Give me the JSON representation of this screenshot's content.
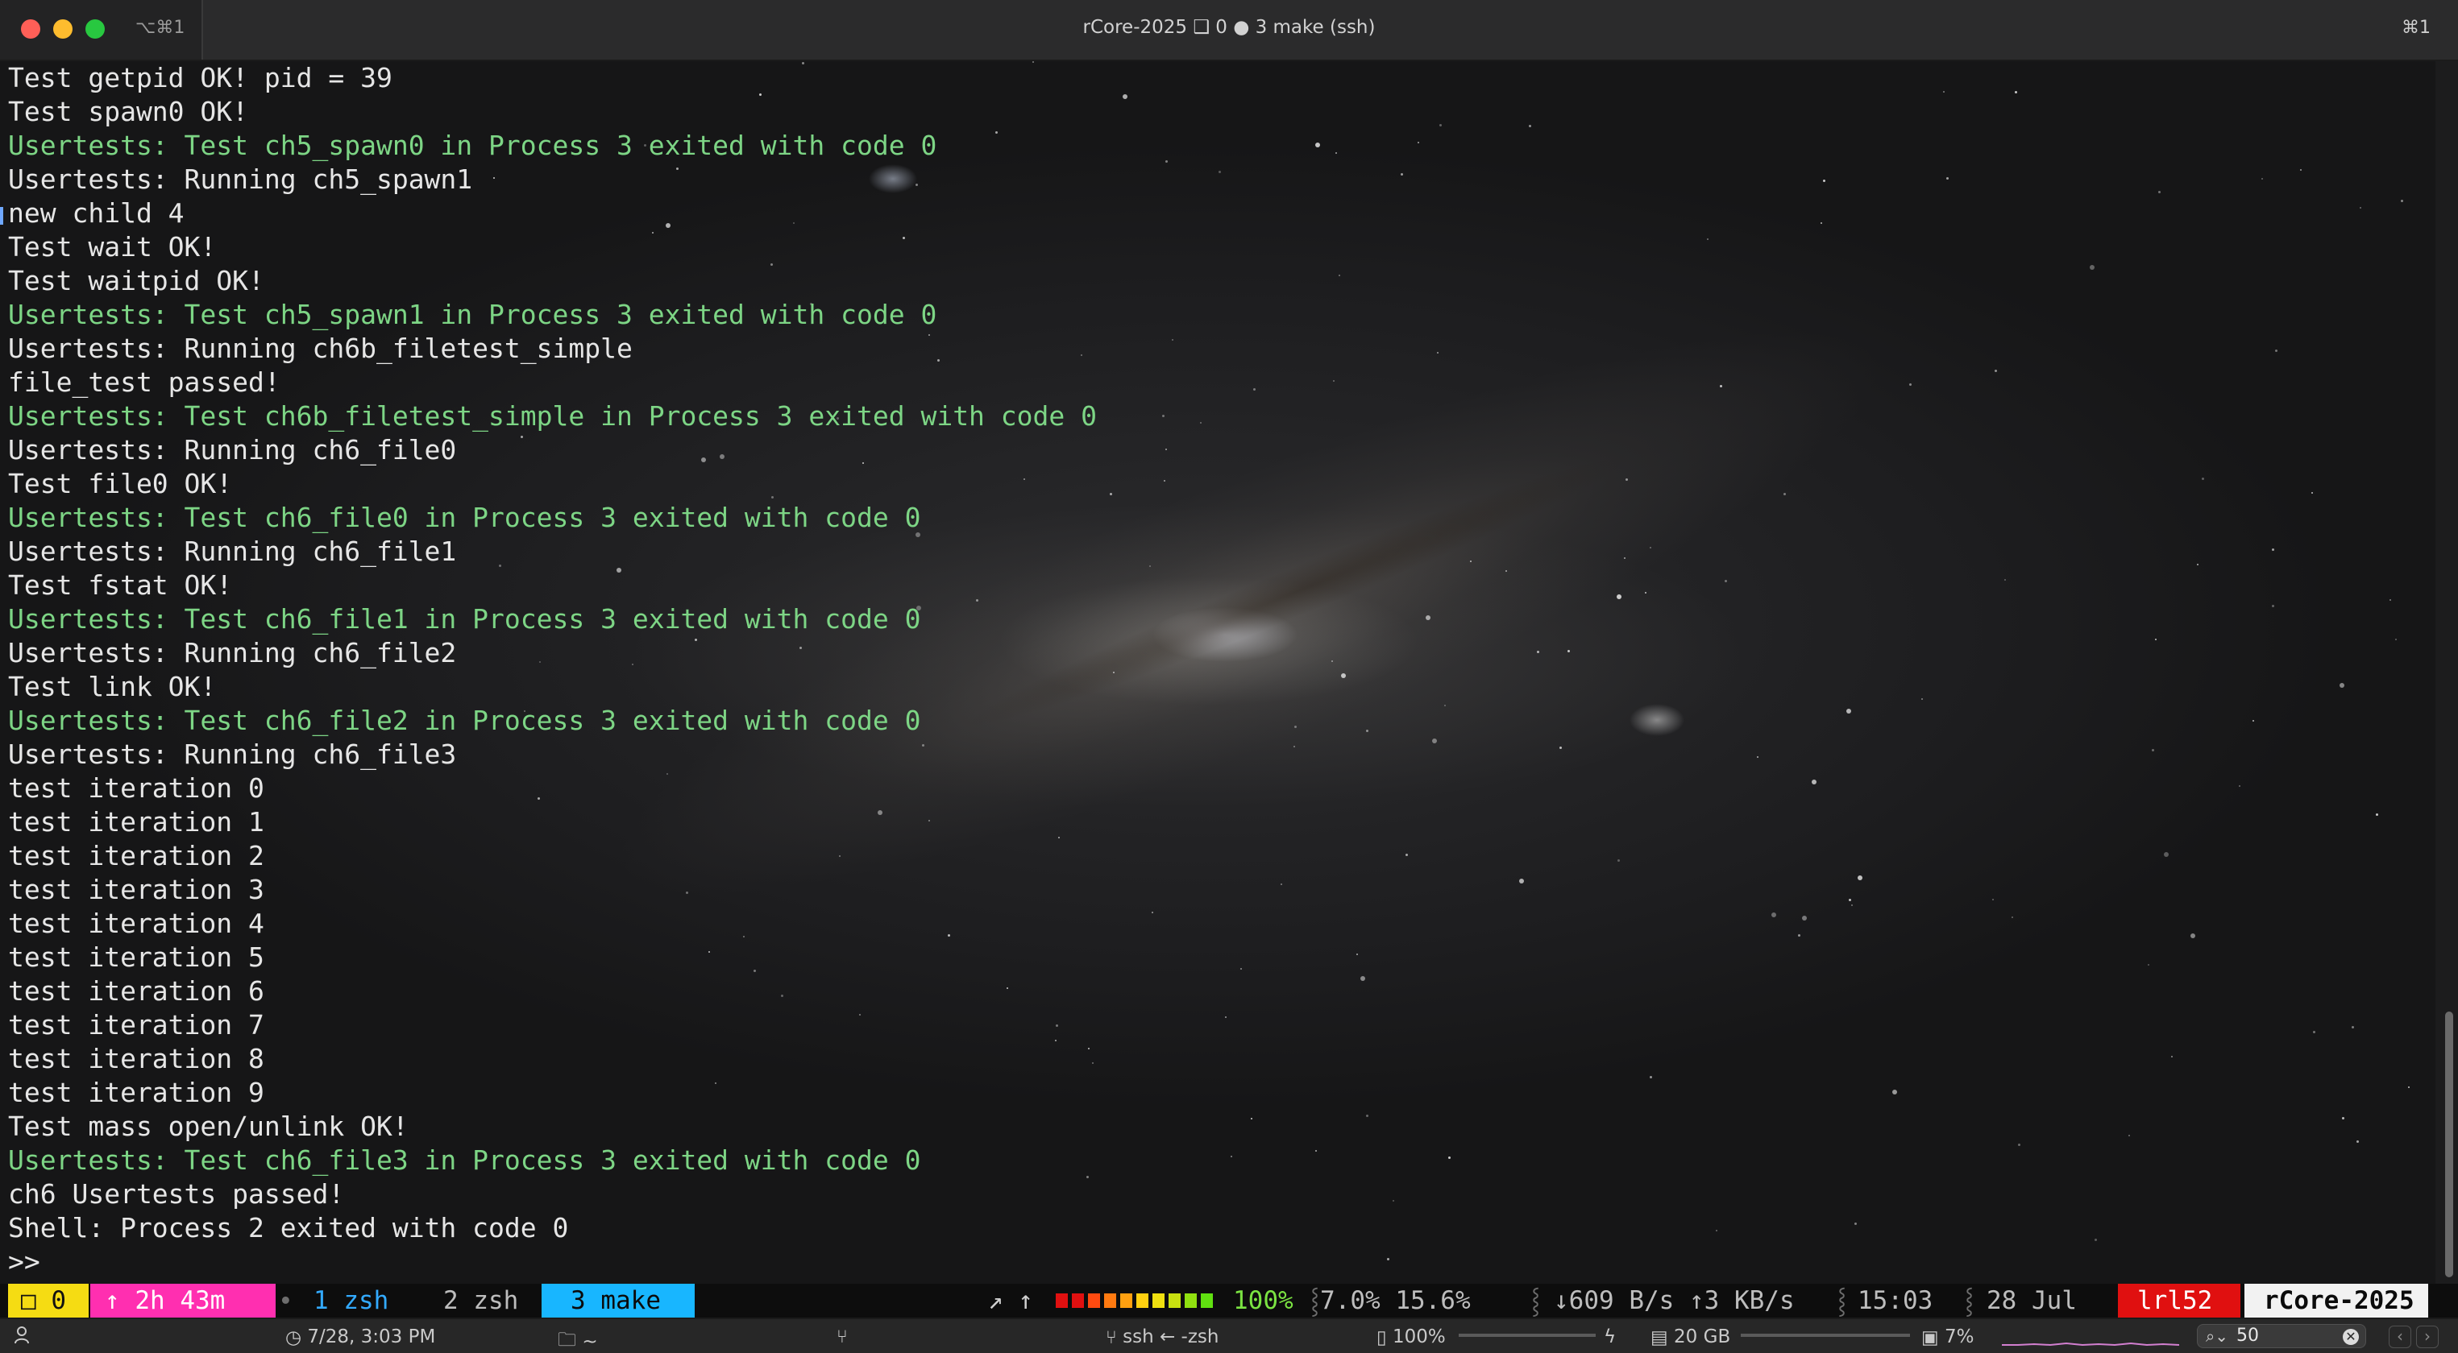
{
  "window": {
    "title": "rCore-2025 ❑ 0 ● 3 make (ssh)",
    "tab_shortcut": "⌥⌘1",
    "window_shortcut": "⌘1"
  },
  "terminal": {
    "lines": [
      {
        "text": "Test getpid OK! pid = 39",
        "color": "default"
      },
      {
        "text": "Test spawn0 OK!",
        "color": "default"
      },
      {
        "text": "Usertests: Test ch5_spawn0 in Process 3 exited with code 0",
        "color": "green"
      },
      {
        "text": "Usertests: Running ch5_spawn1",
        "color": "default"
      },
      {
        "text": "new child 4",
        "color": "default"
      },
      {
        "text": "Test wait OK!",
        "color": "default"
      },
      {
        "text": "Test waitpid OK!",
        "color": "default"
      },
      {
        "text": "Usertests: Test ch5_spawn1 in Process 3 exited with code 0",
        "color": "green"
      },
      {
        "text": "Usertests: Running ch6b_filetest_simple",
        "color": "default"
      },
      {
        "text": "file_test passed!",
        "color": "default"
      },
      {
        "text": "Usertests: Test ch6b_filetest_simple in Process 3 exited with code 0",
        "color": "green"
      },
      {
        "text": "Usertests: Running ch6_file0",
        "color": "default"
      },
      {
        "text": "Test file0 OK!",
        "color": "default"
      },
      {
        "text": "Usertests: Test ch6_file0 in Process 3 exited with code 0",
        "color": "green"
      },
      {
        "text": "Usertests: Running ch6_file1",
        "color": "default"
      },
      {
        "text": "Test fstat OK!",
        "color": "default"
      },
      {
        "text": "Usertests: Test ch6_file1 in Process 3 exited with code 0",
        "color": "green"
      },
      {
        "text": "Usertests: Running ch6_file2",
        "color": "default"
      },
      {
        "text": "Test link OK!",
        "color": "default"
      },
      {
        "text": "Usertests: Test ch6_file2 in Process 3 exited with code 0",
        "color": "green"
      },
      {
        "text": "Usertests: Running ch6_file3",
        "color": "default"
      },
      {
        "text": "test iteration 0",
        "color": "default"
      },
      {
        "text": "test iteration 1",
        "color": "default"
      },
      {
        "text": "test iteration 2",
        "color": "default"
      },
      {
        "text": "test iteration 3",
        "color": "default"
      },
      {
        "text": "test iteration 4",
        "color": "default"
      },
      {
        "text": "test iteration 5",
        "color": "default"
      },
      {
        "text": "test iteration 6",
        "color": "default"
      },
      {
        "text": "test iteration 7",
        "color": "default"
      },
      {
        "text": "test iteration 8",
        "color": "default"
      },
      {
        "text": "test iteration 9",
        "color": "default"
      },
      {
        "text": "Test mass open/unlink OK!",
        "color": "default"
      },
      {
        "text": "Usertests: Test ch6_file3 in Process 3 exited with code 0",
        "color": "green"
      },
      {
        "text": "ch6 Usertests passed!",
        "color": "default"
      },
      {
        "text": "Shell: Process 2 exited with code 0",
        "color": "default"
      },
      {
        "text": ">>",
        "color": "default"
      }
    ]
  },
  "tmux": {
    "session": "□ 0",
    "uptime": "↑ 2h 43m",
    "windows": [
      {
        "label": "1 zsh"
      },
      {
        "label": "2 zsh"
      },
      {
        "label": "3 make"
      }
    ],
    "arrows": "↗ ↑",
    "battery": "100%",
    "cpu_load": "7.0% 15.6%",
    "network": "↓609 B/s ↑3 KB/s",
    "time": "15:03",
    "date": "28 Jul",
    "user": "lrl52",
    "host": "rCore-2025"
  },
  "statusbar": {
    "clock": "7/28, 3:03 PM",
    "directory": "~",
    "ssh": "ssh ← -zsh",
    "battery": "100%",
    "memory": "20 GB",
    "cpu": "7%",
    "search_value": "50"
  },
  "colors": {
    "green_output": "#7dd585",
    "default_output": "#e6e6e6",
    "tmux_session": "#f5dc13",
    "tmux_uptime": "#ff2fb0",
    "tmux_active_window": "#18b6ff",
    "tmux_user": "#e01010"
  }
}
